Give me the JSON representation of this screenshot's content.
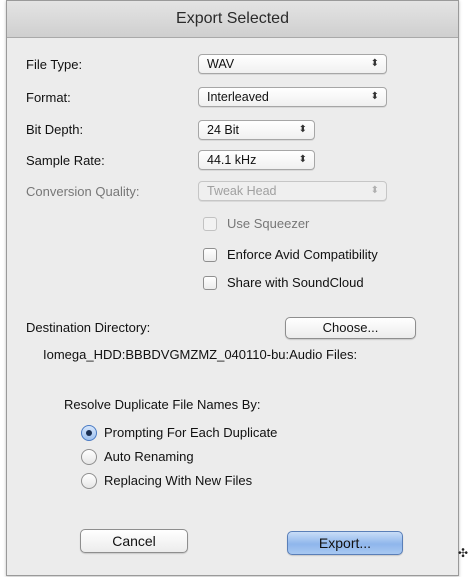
{
  "dialog": {
    "title": "Export Selected"
  },
  "fields": {
    "file_type": {
      "label": "File Type:",
      "value": "WAV"
    },
    "format": {
      "label": "Format:",
      "value": "Interleaved"
    },
    "bit_depth": {
      "label": "Bit Depth:",
      "value": "24 Bit"
    },
    "sample_rate": {
      "label": "Sample Rate:",
      "value": "44.1 kHz"
    },
    "conversion_quality": {
      "label": "Conversion Quality:",
      "value": "Tweak Head",
      "enabled": false
    }
  },
  "options": {
    "use_squeezer": {
      "label": "Use Squeezer",
      "checked": false,
      "enabled": false
    },
    "enforce_avid": {
      "label": "Enforce Avid Compatibility",
      "checked": false
    },
    "share_soundcloud": {
      "label": "Share with SoundCloud",
      "checked": false
    }
  },
  "destination": {
    "label": "Destination Directory:",
    "choose_label": "Choose...",
    "path": "Iomega_HDD:BBBDVGMZMZ_040110-bu:Audio Files:"
  },
  "duplicates": {
    "label": "Resolve Duplicate File Names By:",
    "options": [
      {
        "label": "Prompting For Each Duplicate",
        "selected": true
      },
      {
        "label": "Auto Renaming",
        "selected": false
      },
      {
        "label": "Replacing With New Files",
        "selected": false
      }
    ]
  },
  "buttons": {
    "cancel": "Cancel",
    "export": "Export..."
  },
  "icons": {
    "popup_arrows": "⇕",
    "cursor": "crosshair-cursor-icon"
  }
}
